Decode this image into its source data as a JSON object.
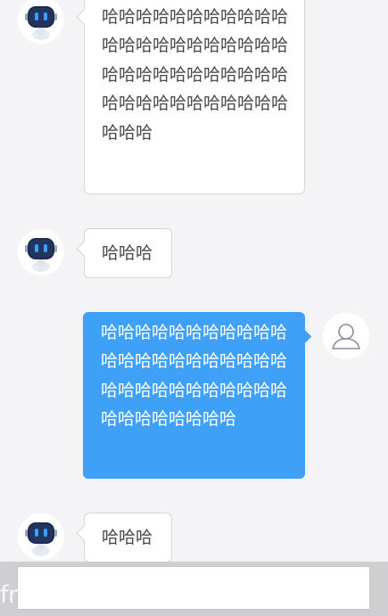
{
  "messages": [
    {
      "sender": "bot",
      "text": "哈哈哈哈哈哈哈哈哈哈哈哈哈哈哈哈哈哈哈哈哈哈哈哈哈哈哈哈哈哈哈哈哈哈哈哈哈哈哈哈哈哈哈哈哈哈哈"
    },
    {
      "sender": "bot",
      "text": "哈哈哈"
    },
    {
      "sender": "user",
      "text": "哈哈哈哈哈哈哈哈哈哈哈哈哈哈哈哈哈哈哈哈哈哈哈哈哈哈哈哈哈哈哈哈哈哈哈哈哈哈哈哈哈"
    },
    {
      "sender": "bot",
      "text": "哈哈哈"
    }
  ],
  "input": {
    "value": "",
    "placeholder": ""
  },
  "watermark": "free for personal use",
  "colors": {
    "background": "#f4f4f6",
    "user_bubble": "#3fa0f7",
    "bot_bubble": "#ffffff",
    "bot_avatar_face": "#1c2b4f",
    "bot_avatar_eyes": "#3aa0ff"
  }
}
